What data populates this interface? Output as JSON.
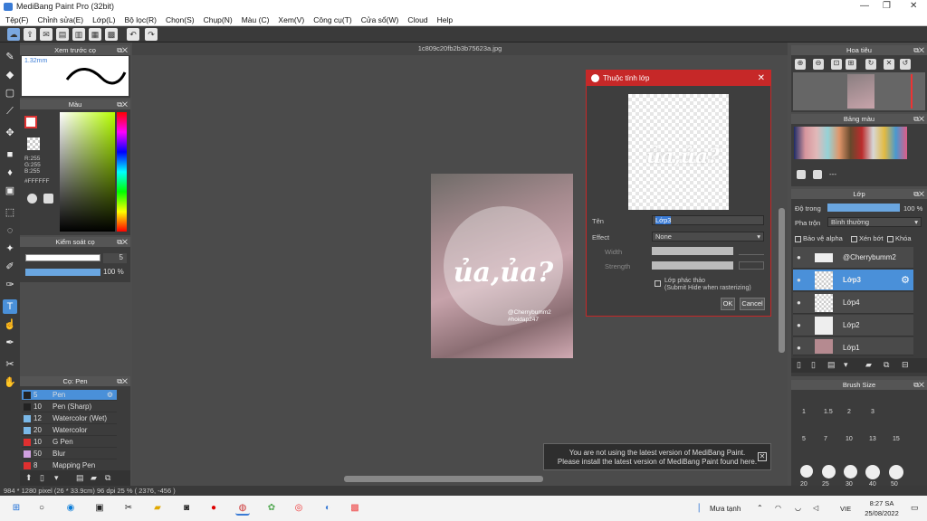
{
  "window": {
    "title": "MediBang Paint Pro (32bit)"
  },
  "menu": [
    "Tệp(F)",
    "Chỉnh sửa(E)",
    "Lớp(L)",
    "Bộ lọc(R)",
    "Chọn(S)",
    "Chụp(N)",
    "Màu (C)",
    "Xem(V)",
    "Công cụ(T)",
    "Cửa sổ(W)",
    "Cloud",
    "Help"
  ],
  "panels": {
    "preview": {
      "title": "Xem trước cọ",
      "size": "1.32mm"
    },
    "color": {
      "title": "Màu",
      "r": "R:255",
      "g": "G:255",
      "b": "B:255",
      "hex": "#FFFFFF"
    },
    "brush_control": {
      "title": "Kiểm soát cọ",
      "size": "5",
      "opacity": "100 %"
    },
    "brush": {
      "title": "Cọ: Pen",
      "items": [
        {
          "size": "5",
          "name": "Pen",
          "color": "#222222"
        },
        {
          "size": "10",
          "name": "Pen (Sharp)",
          "color": "#222222"
        },
        {
          "size": "12",
          "name": "Watercolor (Wet)",
          "color": "#7ab8e8"
        },
        {
          "size": "20",
          "name": "Watercolor",
          "color": "#7ab8e8"
        },
        {
          "size": "10",
          "name": "G Pen",
          "color": "#e03030"
        },
        {
          "size": "50",
          "name": "Blur",
          "color": "#d0a0e0"
        },
        {
          "size": "8",
          "name": "Mapping Pen",
          "color": "#e03030"
        }
      ]
    },
    "navigator": {
      "title": "Hoa tiêu"
    },
    "palette": {
      "title": "Bảng màu",
      "extra": "---"
    },
    "layer": {
      "title": "Lớp",
      "opacity_label": "Độ trong",
      "opacity": "100 %",
      "blend_label": "Pha trộn",
      "blend": "Bình thường",
      "protect_alpha": "Bảo vệ alpha",
      "clipping": "Xén bớt",
      "lock": "Khóa",
      "layers": [
        {
          "name": "@Cherrybumm2"
        },
        {
          "name": "Lớp3"
        },
        {
          "name": "Lớp4"
        },
        {
          "name": "Lớp2"
        },
        {
          "name": "Lớp1"
        }
      ]
    },
    "brush_size": {
      "title": "Brush Size",
      "sizes": [
        "1",
        "1.5",
        "2",
        "3",
        "5",
        "7",
        "10",
        "13",
        "15",
        "20",
        "25",
        "30",
        "40",
        "50"
      ]
    }
  },
  "document": {
    "tab": "1c809c20fb2b3b75623a.jpg",
    "big_text": "ủa,ủa?",
    "handle1": "@Cherrybumm2",
    "handle2": "#hoidap247"
  },
  "dialog": {
    "title": "Thuộc tính lớp",
    "name_label": "Tên",
    "name_value": "Lớp3",
    "effect_label": "Effect",
    "effect_value": "None",
    "width_label": "Width",
    "strength_label": "Strength",
    "draft_label": "Lớp phác thảo",
    "draft_note": "(Submit Hide when rasterizing)",
    "ok": "OK",
    "cancel": "Cancel"
  },
  "notice": {
    "line1": "You are not using the latest version of MediBang Paint.",
    "line2": "Please install the latest version of MediBang Paint found here."
  },
  "status": {
    "text": "984 * 1280 pixel   (26 * 33.9cm)   96 dpi   25 %   ( 2376, -456 )"
  },
  "taskbar": {
    "weather": "Mưa tạnh",
    "lang": "VIE",
    "time": "8:27 SA",
    "date": "25/08/2022"
  }
}
